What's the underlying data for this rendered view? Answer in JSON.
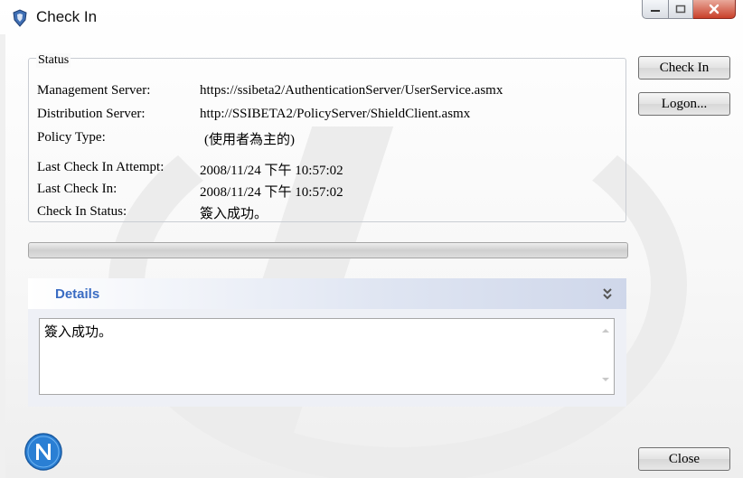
{
  "window": {
    "title": "Check In"
  },
  "status": {
    "group_title": "Status",
    "rows": [
      {
        "label": "Management Server:",
        "value": "https://ssibeta2/AuthenticationServer/UserService.asmx"
      },
      {
        "label": "Distribution Server:",
        "value": "http://SSIBETA2/PolicyServer/ShieldClient.asmx"
      },
      {
        "label": "Policy Type:",
        "value": "(使用者為主的)"
      },
      {
        "label": "Last Check In Attempt:",
        "value": "2008/11/24 下午 10:57:02"
      },
      {
        "label": "Last Check In:",
        "value": "2008/11/24 下午 10:57:02"
      },
      {
        "label": "Check In Status:",
        "value": "簽入成功。"
      }
    ]
  },
  "buttons": {
    "check_in": "Check In",
    "logon": "Logon...",
    "close": "Close"
  },
  "progress": {
    "value_percent": 0
  },
  "details": {
    "title": "Details",
    "text": "簽入成功。"
  },
  "colors": {
    "details_title": "#3a6cc3",
    "logo": "#2a7fd4"
  },
  "icons": {
    "app": "shield-app-icon",
    "logo": "n-logo-icon",
    "chevron": "double-chevron-down-icon"
  }
}
